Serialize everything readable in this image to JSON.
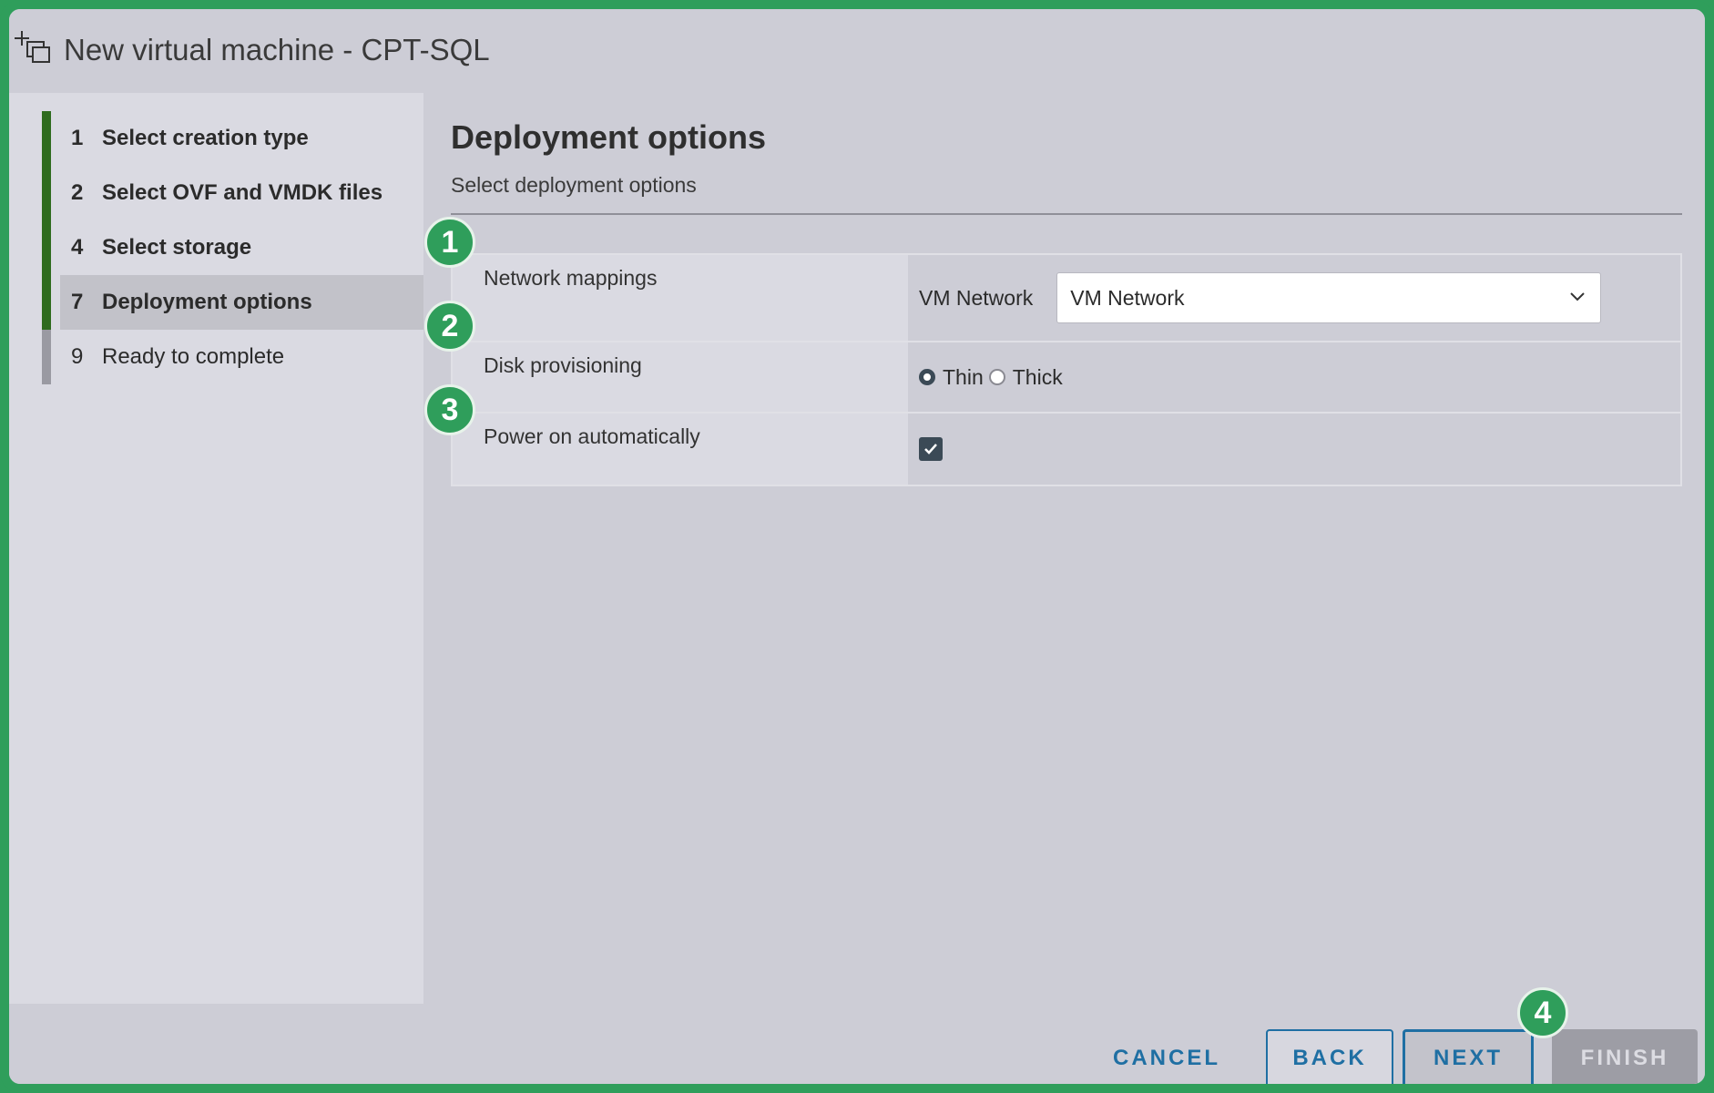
{
  "window": {
    "title": "New virtual machine - CPT-SQL",
    "icon": "new-vm-icon"
  },
  "steps": [
    {
      "num": "1",
      "label": "Select creation type",
      "state": "done"
    },
    {
      "num": "2",
      "label": "Select OVF and VMDK files",
      "state": "done"
    },
    {
      "num": "4",
      "label": "Select storage",
      "state": "done"
    },
    {
      "num": "7",
      "label": "Deployment options",
      "state": "active"
    },
    {
      "num": "9",
      "label": "Ready to complete",
      "state": "pending"
    }
  ],
  "main": {
    "heading": "Deployment options",
    "subheading": "Select deployment options"
  },
  "options": {
    "network": {
      "label": "Network mappings",
      "source": "VM Network",
      "selected": "VM Network"
    },
    "disk": {
      "label": "Disk provisioning",
      "thin": "Thin",
      "thick": "Thick",
      "selected": "Thin"
    },
    "power": {
      "label": "Power on automatically",
      "checked": true
    }
  },
  "annotations": [
    "1",
    "2",
    "3",
    "4"
  ],
  "footer": {
    "cancel": "CANCEL",
    "back": "BACK",
    "next": "NEXT",
    "finish": "FINISH"
  },
  "colors": {
    "accent_green": "#2f9e5b",
    "progress_green": "#2e6b1e",
    "link_blue": "#1f6fa3"
  }
}
